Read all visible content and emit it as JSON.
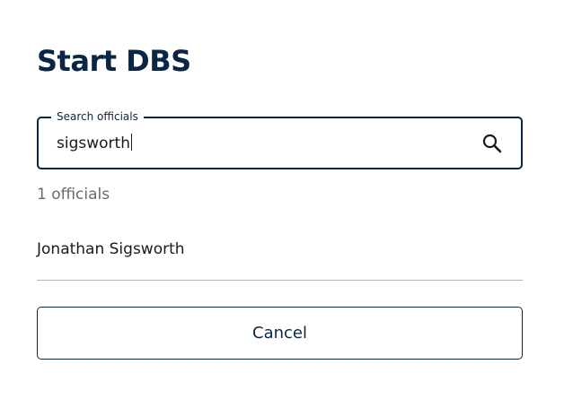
{
  "dialog": {
    "title": "Start DBS"
  },
  "search": {
    "label": "Search officials",
    "value": "sigsworth",
    "icon": "search-icon"
  },
  "results": {
    "count_text": "1 officials",
    "items": [
      {
        "name": "Jonathan Sigsworth"
      }
    ]
  },
  "actions": {
    "cancel_label": "Cancel"
  },
  "colors": {
    "primary": "#0b2545",
    "muted_text": "#6b6b6b",
    "divider": "#b5b5b5",
    "background": "#ffffff"
  }
}
